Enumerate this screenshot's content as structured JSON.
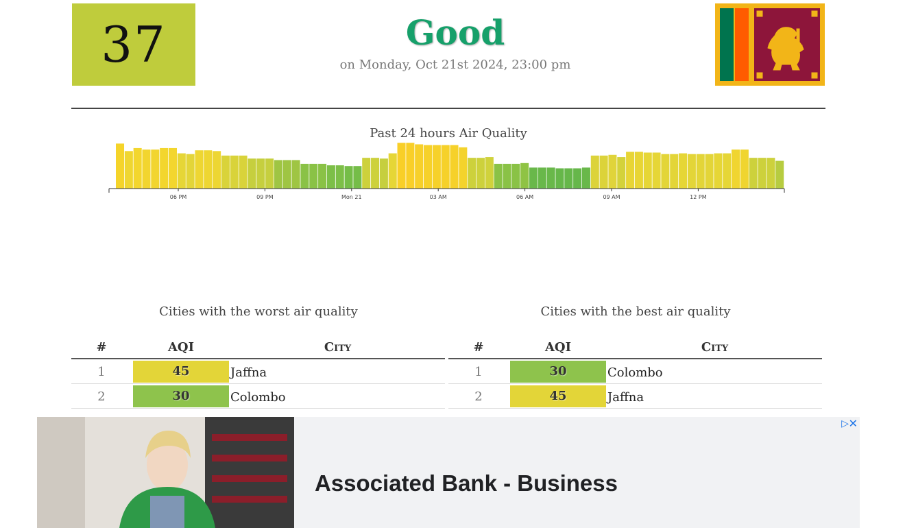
{
  "summary": {
    "aqi": "37",
    "status": "Good",
    "timestamp": "on Monday, Oct 21st 2024, 23:00 pm",
    "aqi_color": "#bfcc3c",
    "status_color": "#16a06a"
  },
  "flag": {
    "icon": "sri-lanka-flag-icon"
  },
  "chart_data": {
    "type": "bar",
    "title": "Past 24 hours Air Quality",
    "xlabel": "",
    "ylabel": "",
    "x_ticks": [
      "06 PM",
      "09 PM",
      "Mon 21",
      "03 AM",
      "06 AM",
      "09 AM",
      "12 PM"
    ],
    "values": [
      60,
      50,
      54,
      52,
      52,
      54,
      54,
      47,
      46,
      51,
      51,
      50,
      44,
      44,
      44,
      40,
      40,
      40,
      38,
      38,
      38,
      33,
      33,
      33,
      31,
      31,
      30,
      30,
      41,
      41,
      40,
      47,
      61,
      61,
      59,
      58,
      58,
      58,
      58,
      55,
      41,
      41,
      42,
      33,
      33,
      33,
      34,
      28,
      28,
      28,
      27,
      27,
      27,
      28,
      44,
      44,
      45,
      42,
      49,
      49,
      48,
      48,
      46,
      46,
      47,
      46,
      46,
      46,
      47,
      47,
      52,
      52,
      41,
      41,
      41,
      37
    ],
    "colors": [
      "#f5d42a",
      "#efd631",
      "#f3d62e",
      "#f2d52f",
      "#f2d52f",
      "#f3d62e",
      "#f3d62e",
      "#e6d636",
      "#e3d538",
      "#eed632",
      "#eed632",
      "#edd633",
      "#d9d33a",
      "#d9d33a",
      "#d9d33a",
      "#c6cf3e",
      "#c6cf3e",
      "#c6cf3e",
      "#9fc543",
      "#9fc543",
      "#9fc543",
      "#8ac246",
      "#8ac246",
      "#8ac246",
      "#7dbf48",
      "#7dbf48",
      "#75bd48",
      "#75bd48",
      "#cdd13c",
      "#cdd13c",
      "#c6cf3e",
      "#e6d636",
      "#f9cf28",
      "#f9cf28",
      "#f7d02a",
      "#f6d12a",
      "#f6d12a",
      "#f6d12a",
      "#f6d12a",
      "#f4d32c",
      "#cdd13c",
      "#cdd13c",
      "#d0d23c",
      "#8ac246",
      "#8ac246",
      "#8ac246",
      "#8fc344",
      "#69b84a",
      "#69b84a",
      "#69b84a",
      "#66b74a",
      "#66b74a",
      "#66b74a",
      "#69b84a",
      "#dcd33a",
      "#dcd33a",
      "#e0d43a",
      "#d4d23a",
      "#e8d535",
      "#e8d535",
      "#e6d636",
      "#e6d636",
      "#e3d538",
      "#e3d538",
      "#e6d636",
      "#e3d538",
      "#e3d538",
      "#e3d538",
      "#e6d636",
      "#e6d636",
      "#f0d530",
      "#f0d530",
      "#cdd13c",
      "#cdd13c",
      "#cdd13c",
      "#b7cc40"
    ]
  },
  "worst": {
    "title": "Cities with the worst air quality",
    "headers": {
      "num": "#",
      "aqi": "AQI",
      "city": "City"
    },
    "rows": [
      {
        "rank": "1",
        "aqi": "45",
        "city": "Jaffna",
        "color": "#e3d538"
      },
      {
        "rank": "2",
        "aqi": "30",
        "city": "Colombo",
        "color": "#8ec34c"
      }
    ]
  },
  "best": {
    "title": "Cities with the best air quality",
    "headers": {
      "num": "#",
      "aqi": "AQI",
      "city": "City"
    },
    "rows": [
      {
        "rank": "1",
        "aqi": "30",
        "city": "Colombo",
        "color": "#8ec34c"
      },
      {
        "rank": "2",
        "aqi": "45",
        "city": "Jaffna",
        "color": "#e3d538"
      }
    ]
  },
  "ad": {
    "headline": "Associated Bank - Business",
    "choices_icon": "adchoices-icon",
    "close_icon": "close-icon"
  }
}
